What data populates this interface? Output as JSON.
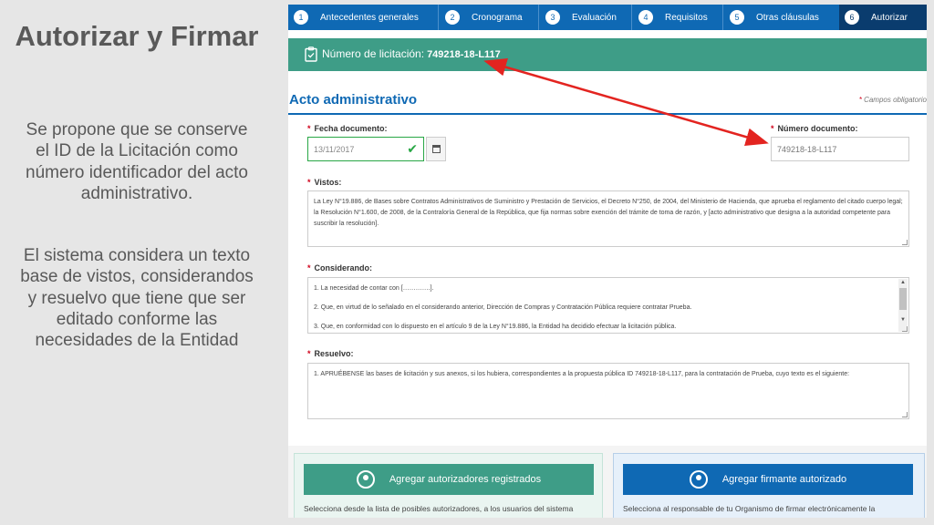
{
  "slide": {
    "title": "Autorizar y Firmar",
    "paragraph_1": "Se propone que se conserve el ID de la Licitación como número identificador del acto administrativo.",
    "paragraph_2": "El sistema considera un texto base de vistos, considerandos y resuelvo que tiene que ser editado conforme las necesidades de la Entidad"
  },
  "stepper": {
    "steps": [
      {
        "num": "1",
        "label": "Antecedentes generales"
      },
      {
        "num": "2",
        "label": "Cronograma"
      },
      {
        "num": "3",
        "label": "Evaluación"
      },
      {
        "num": "4",
        "label": "Requisitos"
      },
      {
        "num": "5",
        "label": "Otras cláusulas"
      },
      {
        "num": "6",
        "label": "Autorizar"
      }
    ],
    "active_step": "6"
  },
  "licitacion": {
    "label": "Número de licitación:",
    "value": "749218-18-L117",
    "icon": "clipboard-icon"
  },
  "form": {
    "section_title": "Acto administrativo",
    "required_note": "Campos obligatorios",
    "required_mark": "*",
    "fecha_label": "Fecha documento:",
    "fecha_value": "13/11/2017",
    "numero_label": "Número documento:",
    "numero_value": "749218-18-L117",
    "vistos_label": "Vistos:",
    "vistos_text": "La Ley N°19.886, de Bases sobre Contratos Administrativos de Suministro y Prestación de Servicios, el Decreto N°250, de 2004, del Ministerio de Hacienda, que aprueba el reglamento del citado cuerpo legal; la Resolución N°1.600, de 2008, de la Contraloría General de la República, que fija normas sobre exención del trámite de toma de razón, y [acto administrativo que designa a la autoridad competente para suscribir la resolución].",
    "considerando_label": "Considerando:",
    "considerando_lines": [
      "1. La necesidad de contar con [………….].",
      "2. Que, en virtud de lo señalado en el considerando anterior, Dirección de Compras y Contratación Pública requiere contratar Prueba.",
      "3. Que, en conformidad con lo dispuesto en el artículo 9 de la Ley N°19.886, la Entidad ha decidido efectuar la licitación pública."
    ],
    "resuelvo_label": "Resuelvo:",
    "resuelvo_text": "1. APRUÉBENSE las bases de licitación y sus anexos, si los hubiera, correspondientes a la propuesta pública ID 749218-18-L117, para la contratación de Prueba, cuyo texto es el siguiente:"
  },
  "cards": {
    "left_button": "Agregar autorizadores registrados",
    "left_desc": "Selecciona desde la lista de posibles autorizadores, a los usuarios del sistema",
    "right_button": "Agregar firmante autorizado",
    "right_desc": "Selecciona al responsable de tu Organismo de firmar electrónicamente la"
  },
  "colors": {
    "step_blue": "#0f69b4",
    "step_active": "#0a3c6e",
    "green": "#3e9d87",
    "arrow_red": "#e32420"
  }
}
